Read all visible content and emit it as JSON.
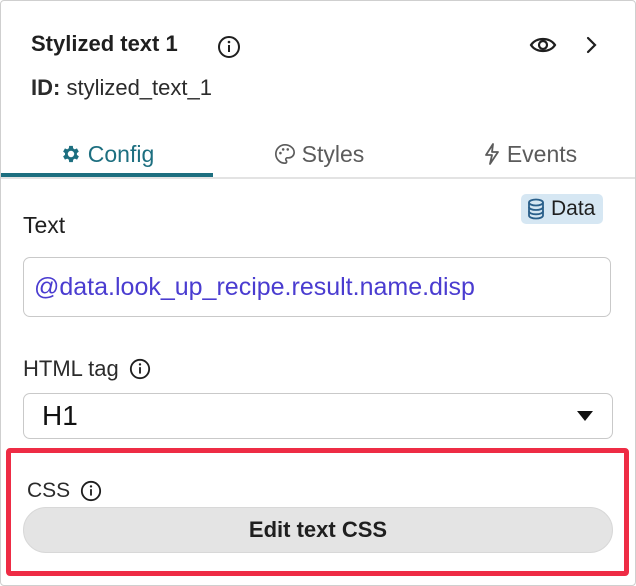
{
  "header": {
    "title": "Stylized text 1",
    "id_label": "ID:",
    "id_value": "stylized_text_1"
  },
  "tabs": [
    {
      "label": "Config",
      "active": true,
      "icon": "gear-icon"
    },
    {
      "label": "Styles",
      "active": false,
      "icon": "palette-icon"
    },
    {
      "label": "Events",
      "active": false,
      "icon": "lightning-icon"
    }
  ],
  "data_badge": {
    "label": "Data",
    "icon": "database-icon"
  },
  "text_field": {
    "label": "Text",
    "value": "@data.look_up_recipe.result.name.disp"
  },
  "html_tag": {
    "label": "HTML tag",
    "selected": "H1"
  },
  "css": {
    "label": "CSS",
    "button_label": "Edit text CSS"
  },
  "colors": {
    "accent": "#1d6f80",
    "binding_text": "#4a3cd0",
    "highlight_border": "#ee2c45",
    "badge_bg": "#d6e7f3"
  }
}
